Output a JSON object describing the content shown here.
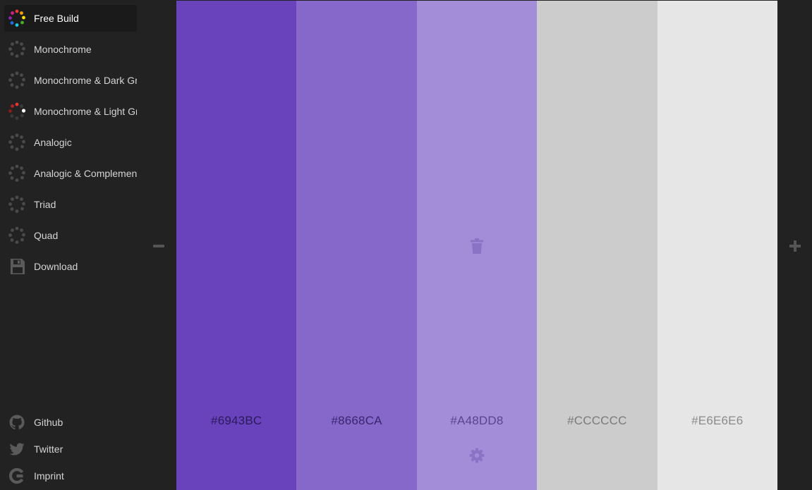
{
  "sidebar": {
    "items": [
      {
        "label": "Free Build",
        "icon": "color-wheel-icon",
        "active": true
      },
      {
        "label": "Monochrome",
        "icon": "color-wheel-icon"
      },
      {
        "label": "Monochrome & Dark Gray",
        "icon": "color-wheel-icon"
      },
      {
        "label": "Monochrome & Light Gray",
        "icon": "color-wheel-icon"
      },
      {
        "label": "Analogic",
        "icon": "color-wheel-icon"
      },
      {
        "label": "Analogic & Complementary",
        "icon": "color-wheel-icon"
      },
      {
        "label": "Triad",
        "icon": "color-wheel-icon"
      },
      {
        "label": "Quad",
        "icon": "color-wheel-icon"
      },
      {
        "label": "Download",
        "icon": "floppy-disk-icon"
      }
    ],
    "footer": [
      {
        "label": "Github",
        "icon": "github-icon"
      },
      {
        "label": "Twitter",
        "icon": "twitter-icon"
      },
      {
        "label": "Imprint",
        "icon": "imprint-icon"
      }
    ]
  },
  "palette": {
    "swatches": [
      {
        "hex": "#6943BC",
        "bg": "#6943BC",
        "text_color": "#2a1a5c"
      },
      {
        "hex": "#8668CA",
        "bg": "#8668CA",
        "text_color": "#3a2670"
      },
      {
        "hex": "#A48DD8",
        "bg": "#A48DD8",
        "text_color": "#5a4290"
      },
      {
        "hex": "#CCCCCC",
        "bg": "#CCCCCC",
        "text_color": "#7a7a7a"
      },
      {
        "hex": "#E6E6E6",
        "bg": "#E6E6E6",
        "text_color": "#8a8a8a"
      }
    ]
  },
  "colors": {
    "background": "#222222",
    "sidebar_text": "#d4d4d4",
    "control_icon": "#555555",
    "swatch_icon": "#8a72c4"
  }
}
